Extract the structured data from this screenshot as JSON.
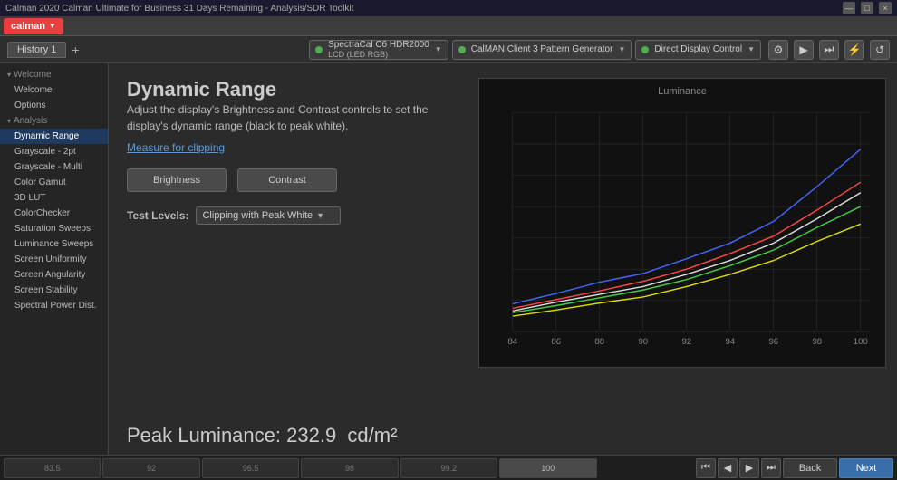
{
  "titleBar": {
    "title": "Calman 2020 Calman Ultimate for Business 31 Days Remaining - Analysis/SDR Toolkit",
    "winControls": [
      "—",
      "□",
      "×"
    ]
  },
  "menuBar": {
    "logo": "calman",
    "dropdownArrow": "▼"
  },
  "toolbar": {
    "historyTab": "History 1",
    "historyAdd": "+",
    "devices": [
      {
        "name": "SpectraCal C6 HDR2000",
        "sub": "LCD (LED RGB)",
        "color": "green"
      },
      {
        "name": "CalMAN Client 3 Pattern Generator",
        "sub": "",
        "color": "green"
      },
      {
        "name": "Direct Display Control",
        "sub": "",
        "color": "green"
      }
    ],
    "toolbarIcons": [
      "⚙",
      "▶",
      "⏭",
      "⚡",
      "↺"
    ]
  },
  "sidebar": {
    "sections": [
      {
        "label": "Welcome",
        "items": [
          {
            "label": "Welcome",
            "active": false
          },
          {
            "label": "Options",
            "active": false
          }
        ]
      },
      {
        "label": "Analysis",
        "items": [
          {
            "label": "Dynamic Range",
            "active": true
          },
          {
            "label": "Grayscale - 2pt",
            "active": false
          },
          {
            "label": "Grayscale - Multi",
            "active": false
          },
          {
            "label": "Color Gamut",
            "active": false
          },
          {
            "label": "3D LUT",
            "active": false
          },
          {
            "label": "ColorChecker",
            "active": false
          },
          {
            "label": "Saturation Sweeps",
            "active": false
          },
          {
            "label": "Luminance Sweeps",
            "active": false
          },
          {
            "label": "Screen Uniformity",
            "active": false
          },
          {
            "label": "Screen Angularity",
            "active": false
          },
          {
            "label": "Screen Stability",
            "active": false
          },
          {
            "label": "Spectral Power Dist.",
            "active": false
          }
        ]
      }
    ]
  },
  "content": {
    "title": "Dynamic Range",
    "description": "Adjust the display's Brightness and Contrast controls to set the display's dynamic range (black to peak white).",
    "measureLink": "Measure for clipping",
    "buttons": {
      "brightness": "Brightness",
      "contrast": "Contrast"
    },
    "testLevels": {
      "label": "Test Levels:",
      "value": "Clipping with Peak White",
      "arrow": "▼"
    },
    "peakLuminance": {
      "label": "Peak Luminance:",
      "value": "232.9",
      "unit": "cd/m²"
    }
  },
  "chart": {
    "title": "Luminance",
    "xAxis": [
      84,
      86,
      88,
      90,
      92,
      94,
      96,
      98,
      100
    ],
    "lines": [
      {
        "color": "#4466ff",
        "label": "blue"
      },
      {
        "color": "#ff4444",
        "label": "red"
      },
      {
        "color": "#dddddd",
        "label": "white"
      },
      {
        "color": "#44cc44",
        "label": "green"
      },
      {
        "color": "#dddd00",
        "label": "yellow"
      }
    ]
  },
  "bottomStrip": {
    "thumbs": [
      {
        "label": "83.5",
        "active": false
      },
      {
        "label": "92",
        "active": false
      },
      {
        "label": "96.5",
        "active": false
      },
      {
        "label": "98",
        "active": false
      },
      {
        "label": "99.2",
        "active": false
      },
      {
        "label": "100",
        "active": true
      }
    ],
    "navButtons": {
      "prev1": "⏮",
      "prev2": "◀",
      "next1": "▶",
      "next2": "⏭",
      "back": "Back",
      "next": "Next"
    }
  },
  "icons": {
    "chevron_down": "▾",
    "chevron_right": "▸",
    "gear": "⚙",
    "play": "▶",
    "fast_forward": "⏭",
    "lightning": "⚡",
    "refresh": "↺",
    "rewind": "⏮",
    "back_arrow": "◀",
    "forward_arrow": "▶",
    "skip_end": "⏭"
  }
}
